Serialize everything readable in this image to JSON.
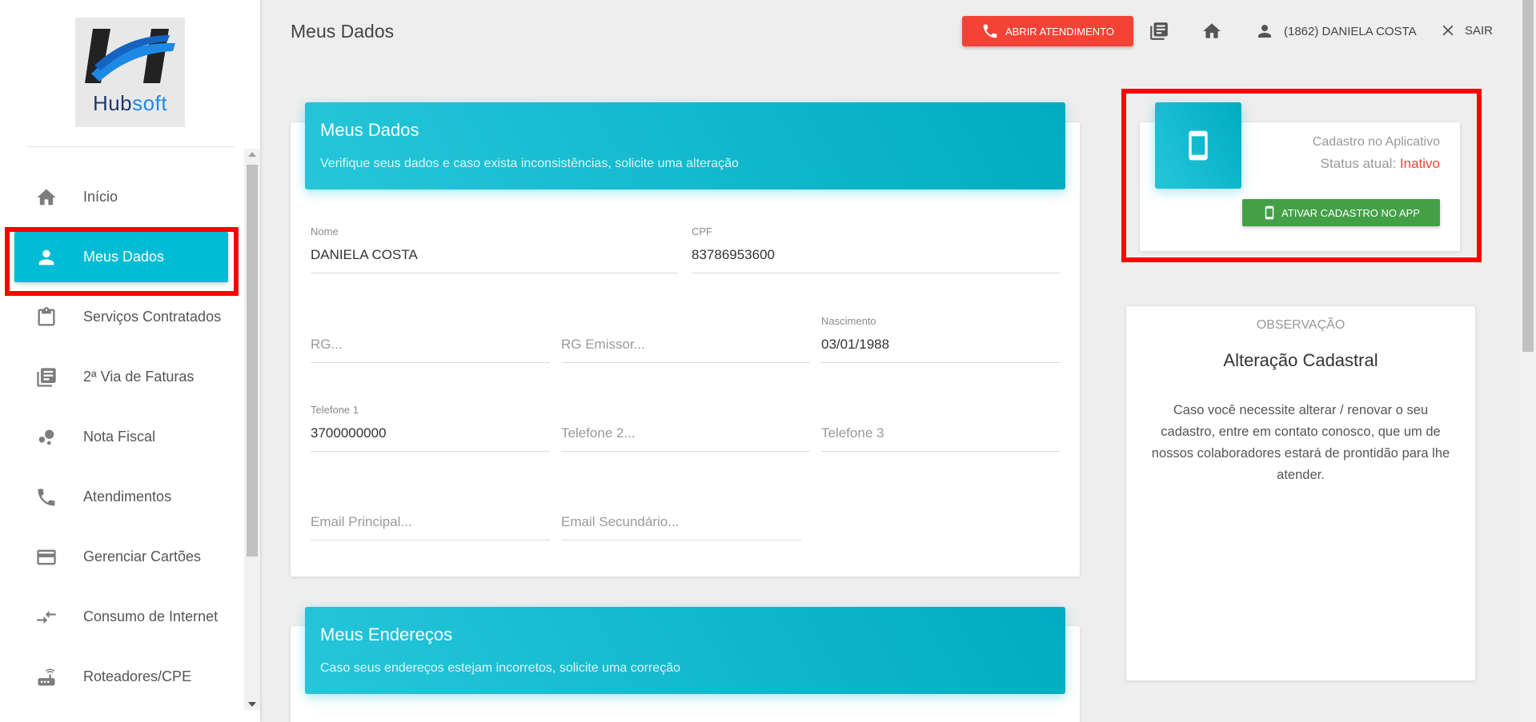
{
  "brand": {
    "logo_hub": "Hub",
    "logo_soft": "soft",
    "accent": "#00bcd4",
    "danger": "#f44336",
    "success": "#43a047"
  },
  "header": {
    "title": "Meus Dados",
    "btn_atendimento": "ABRIR ATENDIMENTO",
    "user": "(1862) DANIELA COSTA",
    "logout": "SAIR"
  },
  "sidebar": {
    "items": [
      {
        "label": "Início",
        "icon": "home-icon"
      },
      {
        "label": "Meus Dados",
        "icon": "person-icon"
      },
      {
        "label": "Serviços Contratados",
        "icon": "clipboard-icon"
      },
      {
        "label": "2ª Via de Faturas",
        "icon": "library-books-icon"
      },
      {
        "label": "Nota Fiscal",
        "icon": "bubble-chart-icon"
      },
      {
        "label": "Atendimentos",
        "icon": "phone-icon"
      },
      {
        "label": "Gerenciar Cartões",
        "icon": "credit-card-icon"
      },
      {
        "label": "Consumo de Internet",
        "icon": "compare-arrows-icon"
      },
      {
        "label": "Roteadores/CPE",
        "icon": "router-icon"
      }
    ]
  },
  "dados": {
    "title": "Meus Dados",
    "subtitle": "Verifique seus dados e caso exista inconsistências, solicite uma alteração",
    "nome_label": "Nome",
    "nome_value": "DANIELA COSTA",
    "cpf_label": "CPF",
    "cpf_value": "83786953600",
    "rg_placeholder": "RG...",
    "rg_emissor_placeholder": "RG Emissor...",
    "nascimento_label": "Nascimento",
    "nascimento_value": "03/01/1988",
    "telefone1_label": "Telefone 1",
    "telefone1_value": "3700000000",
    "telefone2_placeholder": "Telefone 2...",
    "telefone3_placeholder": "Telefone 3",
    "email_principal_placeholder": "Email Principal...",
    "email_secundario_placeholder": "Email Secundário..."
  },
  "enderecos": {
    "title": "Meus Endereços",
    "subtitle": "Caso seus endereços estejam incorretos, solicite uma correção"
  },
  "app": {
    "cadastro_label": "Cadastro no Aplicativo",
    "status_label": "Status atual:",
    "status_value": "Inativo",
    "btn_ativar": "ATIVAR CADASTRO NO APP"
  },
  "observacao": {
    "label": "OBSERVAÇÃO",
    "title": "Alteração Cadastral",
    "text": "Caso você necessite alterar / renovar o seu cadastro, entre em contato conosco, que um de nossos colaboradores estará de prontidão para lhe atender."
  }
}
